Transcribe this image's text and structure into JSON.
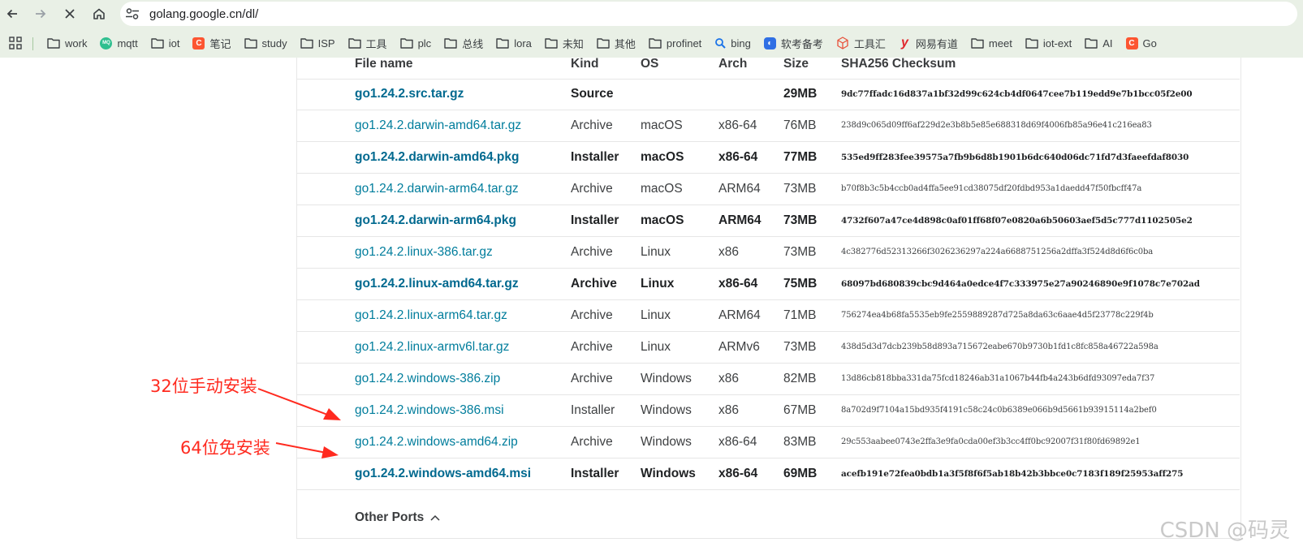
{
  "browser": {
    "url": "golang.google.cn/dl/",
    "bookmarks": [
      {
        "label": "work",
        "icon": "folder-icon"
      },
      {
        "label": "mqtt",
        "icon": "mqtt-logo-icon"
      },
      {
        "label": "iot",
        "icon": "folder-icon"
      },
      {
        "label": "笔记",
        "icon": "csdn-c-icon"
      },
      {
        "label": "study",
        "icon": "folder-icon"
      },
      {
        "label": "ISP",
        "icon": "folder-icon"
      },
      {
        "label": "工具",
        "icon": "folder-icon"
      },
      {
        "label": "plc",
        "icon": "folder-icon"
      },
      {
        "label": "总线",
        "icon": "folder-icon"
      },
      {
        "label": "lora",
        "icon": "folder-icon"
      },
      {
        "label": "未知",
        "icon": "folder-icon"
      },
      {
        "label": "其他",
        "icon": "folder-icon"
      },
      {
        "label": "profinet",
        "icon": "folder-icon"
      },
      {
        "label": "bing",
        "icon": "bing-search-icon"
      },
      {
        "label": "软考备考",
        "icon": "ruankao-icon"
      },
      {
        "label": "工具汇",
        "icon": "cube-icon"
      },
      {
        "label": "网易有道",
        "icon": "youdao-icon"
      },
      {
        "label": "meet",
        "icon": "folder-icon"
      },
      {
        "label": "iot-ext",
        "icon": "folder-icon"
      },
      {
        "label": "AI",
        "icon": "folder-icon"
      },
      {
        "label": "Go",
        "icon": "csdn-c-icon"
      }
    ]
  },
  "table": {
    "headers": {
      "file": "File name",
      "kind": "Kind",
      "os": "OS",
      "arch": "Arch",
      "size": "Size",
      "sha": "SHA256 Checksum"
    },
    "rows": [
      {
        "file": "go1.24.2.src.tar.gz",
        "kind": "Source",
        "os": "",
        "arch": "",
        "size": "29MB",
        "sha": "9dc77ffadc16d837a1bf32d99c624cb4df0647cee7b119edd9e7b1bcc05f2e00",
        "featured": true
      },
      {
        "file": "go1.24.2.darwin-amd64.tar.gz",
        "kind": "Archive",
        "os": "macOS",
        "arch": "x86-64",
        "size": "76MB",
        "sha": "238d9c065d09ff6af229d2e3b8b5e85e688318d69f4006fb85a96e41c216ea83",
        "featured": false
      },
      {
        "file": "go1.24.2.darwin-amd64.pkg",
        "kind": "Installer",
        "os": "macOS",
        "arch": "x86-64",
        "size": "77MB",
        "sha": "535ed9ff283fee39575a7fb9b6d8b1901b6dc640d06dc71fd7d3faeefdaf8030",
        "featured": true
      },
      {
        "file": "go1.24.2.darwin-arm64.tar.gz",
        "kind": "Archive",
        "os": "macOS",
        "arch": "ARM64",
        "size": "73MB",
        "sha": "b70f8b3c5b4ccb0ad4ffa5ee91cd38075df20fdbd953a1daedd47f50fbcff47a",
        "featured": false
      },
      {
        "file": "go1.24.2.darwin-arm64.pkg",
        "kind": "Installer",
        "os": "macOS",
        "arch": "ARM64",
        "size": "73MB",
        "sha": "4732f607a47ce4d898c0af01ff68f07e0820a6b50603aef5d5c777d1102505e2",
        "featured": true
      },
      {
        "file": "go1.24.2.linux-386.tar.gz",
        "kind": "Archive",
        "os": "Linux",
        "arch": "x86",
        "size": "73MB",
        "sha": "4c382776d52313266f3026236297a224a6688751256a2dffa3f524d8d6f6c0ba",
        "featured": false
      },
      {
        "file": "go1.24.2.linux-amd64.tar.gz",
        "kind": "Archive",
        "os": "Linux",
        "arch": "x86-64",
        "size": "75MB",
        "sha": "68097bd680839cbc9d464a0edce4f7c333975e27a90246890e9f1078c7e702ad",
        "featured": true
      },
      {
        "file": "go1.24.2.linux-arm64.tar.gz",
        "kind": "Archive",
        "os": "Linux",
        "arch": "ARM64",
        "size": "71MB",
        "sha": "756274ea4b68fa5535eb9fe2559889287d725a8da63c6aae4d5f23778c229f4b",
        "featured": false
      },
      {
        "file": "go1.24.2.linux-armv6l.tar.gz",
        "kind": "Archive",
        "os": "Linux",
        "arch": "ARMv6",
        "size": "73MB",
        "sha": "438d5d3d7dcb239b58d893a715672eabe670b9730b1fd1c8fc858a46722a598a",
        "featured": false
      },
      {
        "file": "go1.24.2.windows-386.zip",
        "kind": "Archive",
        "os": "Windows",
        "arch": "x86",
        "size": "82MB",
        "sha": "13d86cb818bba331da75fcd18246ab31a1067b44fb4a243b6dfd93097eda7f37",
        "featured": false
      },
      {
        "file": "go1.24.2.windows-386.msi",
        "kind": "Installer",
        "os": "Windows",
        "arch": "x86",
        "size": "67MB",
        "sha": "8a702d9f7104a15bd935f4191c58c24c0b6389e066b9d5661b93915114a2bef0",
        "featured": false
      },
      {
        "file": "go1.24.2.windows-amd64.zip",
        "kind": "Archive",
        "os": "Windows",
        "arch": "x86-64",
        "size": "83MB",
        "sha": "29c553aabee0743e2ffa3e9fa0cda00ef3b3cc4ff0bc92007f31f80fd69892e1",
        "featured": false
      },
      {
        "file": "go1.24.2.windows-amd64.msi",
        "kind": "Installer",
        "os": "Windows",
        "arch": "x86-64",
        "size": "69MB",
        "sha": "acefb191e72fea0bdb1a3f5f8f6f5ab18b42b3bbce0c7183f189f25953aff275",
        "featured": true
      }
    ],
    "other_ports": "Other Ports"
  },
  "annotations": {
    "label_32": "32位手动安装",
    "label_64": "64位免安装",
    "color": "#ff2a1f"
  },
  "watermark": "CSDN @码灵"
}
